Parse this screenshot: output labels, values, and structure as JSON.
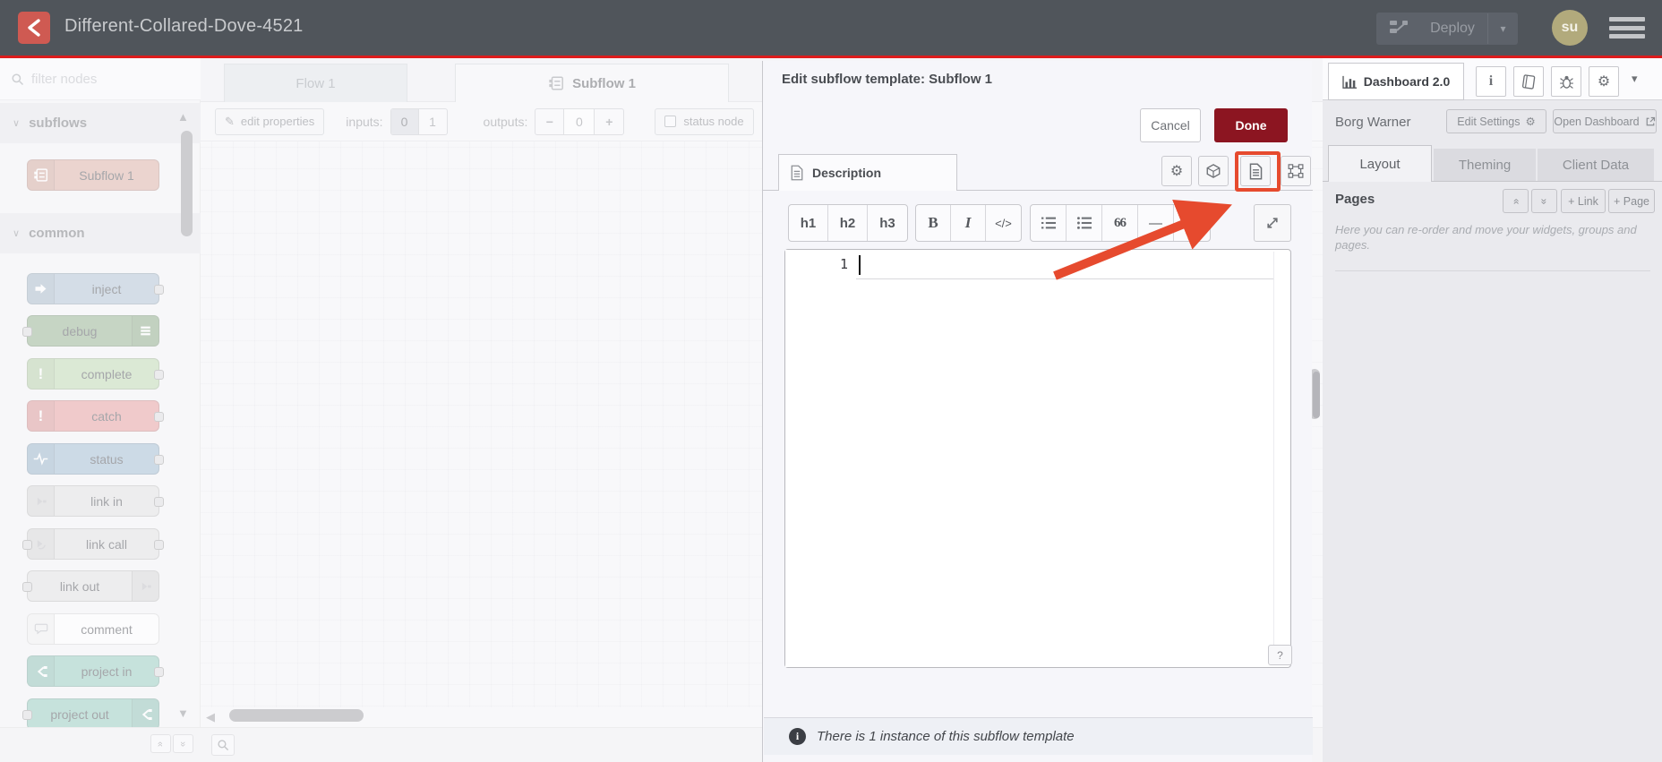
{
  "colors": {
    "accent_red": "#dc1c1c",
    "done_bg": "#8c1521",
    "annotation": "#e64a2e",
    "avatar_bg": "#b2aa7c",
    "logo_bg": "#cf5a52"
  },
  "icons": {
    "pencil": "✎",
    "gear": "⚙",
    "chevron_down": "▾",
    "collapse_up": "▲",
    "collapse_down": "▼",
    "scroll_left": "◀",
    "double_chevron": "»",
    "minus": "−",
    "plus": "+",
    "quote": "66",
    "hr": "—",
    "info_i": "i",
    "help": "?"
  },
  "header": {
    "title": "Different-Collared-Dove-4521",
    "deploy": "Deploy",
    "avatar": "su"
  },
  "palette": {
    "filter_placeholder": "filter nodes",
    "sections": [
      {
        "label": "subflows",
        "nodes": [
          {
            "label": "Subflow 1",
            "color": "#d9a79a"
          }
        ]
      },
      {
        "label": "common",
        "nodes": [
          {
            "label": "inject",
            "color": "#a6bbcf"
          },
          {
            "label": "debug",
            "color": "#87a980"
          },
          {
            "label": "complete",
            "color": "#b5d4a6"
          },
          {
            "label": "catch",
            "color": "#e49191"
          },
          {
            "label": "status",
            "color": "#94b3cd"
          },
          {
            "label": "link in",
            "color": "#dddddd"
          },
          {
            "label": "link call",
            "color": "#dddddd"
          },
          {
            "label": "link out",
            "color": "#dddddd"
          },
          {
            "label": "comment",
            "color": "#ffffff"
          },
          {
            "label": "project in",
            "color": "#87c5b5"
          },
          {
            "label": "project out",
            "color": "#87c5b5"
          }
        ]
      }
    ]
  },
  "workspace": {
    "tabs": [
      {
        "label": "Flow 1"
      },
      {
        "label": "Subflow 1"
      }
    ],
    "toolbar": {
      "edit_properties": "edit properties",
      "inputs_label": "inputs:",
      "inputs_options": [
        "0",
        "1"
      ],
      "outputs_label": "outputs:",
      "outputs_value": "0",
      "status_node": "status node"
    }
  },
  "dialog": {
    "title": "Edit subflow template: Subflow 1",
    "cancel": "Cancel",
    "done": "Done",
    "tab_label": "Description",
    "md_buttons": [
      "h1",
      "h2",
      "h3",
      "B",
      "I",
      "</>"
    ],
    "editor_line_number": "1",
    "footer": "There is 1 instance of this subflow template"
  },
  "sidebar": {
    "tab": "Dashboard 2.0",
    "project_name": "Borg Warner",
    "edit_settings": "Edit Settings",
    "open_dashboard": "Open Dashboard",
    "tabs": [
      "Layout",
      "Theming",
      "Client Data"
    ],
    "pages_title": "Pages",
    "add_link": "+ Link",
    "add_page": "+ Page",
    "pages_help": "Here you can re-order and move your widgets, groups and pages."
  }
}
